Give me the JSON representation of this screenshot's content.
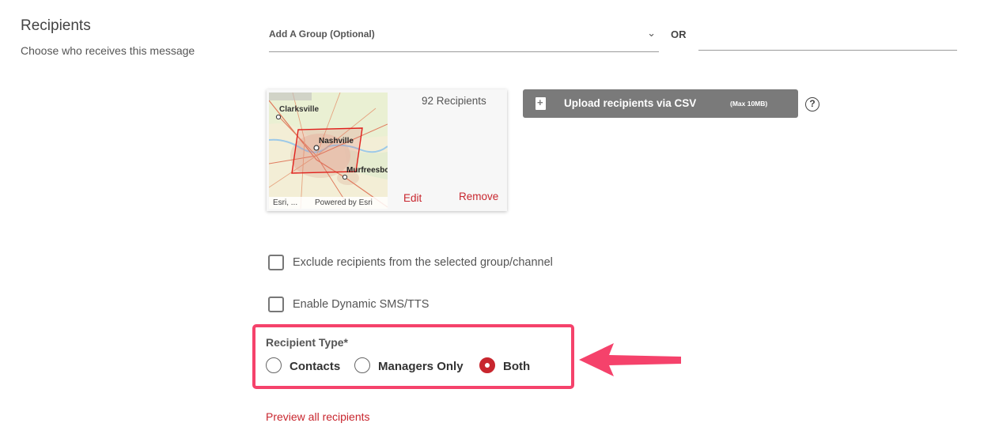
{
  "section": {
    "title": "Recipients",
    "subtitle": "Choose who receives this message"
  },
  "group_select": {
    "placeholder": "Add A Group (Optional)"
  },
  "or_label": "OR",
  "map_card": {
    "recipient_count": "92 Recipients",
    "edit_label": "Edit",
    "remove_label": "Remove",
    "map": {
      "cities": [
        "Clarksville",
        "Nashville",
        "Murfreesbo"
      ],
      "attribution_left": "Esri, ...",
      "attribution_right": "Powered by Esri"
    }
  },
  "upload": {
    "label": "Upload recipients via CSV",
    "max_note": "(Max 10MB)",
    "help_glyph": "?"
  },
  "options": {
    "exclude_label": "Exclude recipients from the selected group/channel",
    "exclude_checked": false,
    "dynamic_label": "Enable Dynamic SMS/TTS",
    "dynamic_checked": false
  },
  "recipient_type": {
    "label": "Recipient Type*",
    "options": [
      "Contacts",
      "Managers Only",
      "Both"
    ],
    "selected": "Both"
  },
  "preview_link": "Preview all recipients",
  "colors": {
    "accent_red": "#c8262e",
    "highlight_pink": "#f5426b",
    "button_gray": "#7a7a7a"
  },
  "icons": {
    "dropdown": "chevron-down-icon",
    "file_upload": "file-plus-icon",
    "help": "question-circle-icon",
    "annotation": "arrow-left-icon"
  }
}
